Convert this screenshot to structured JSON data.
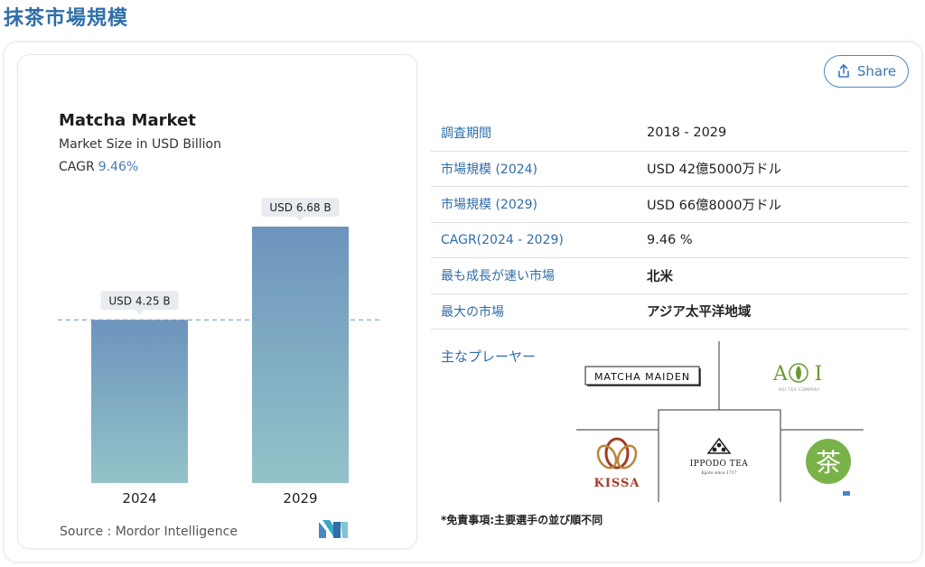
{
  "page_title": "抹茶市場規模",
  "share": {
    "label": "Share",
    "icon": "share-icon"
  },
  "chart": {
    "title": "Matcha Market",
    "subtitle": "Market Size in USD Billion",
    "cagr_label": "CAGR",
    "cagr_value": "9.46%",
    "source": "Source : Mordor Intelligence"
  },
  "chart_data": {
    "type": "bar",
    "categories": [
      "2024",
      "2029"
    ],
    "values": [
      4.25,
      6.68
    ],
    "data_labels": [
      "USD 4.25 B",
      "USD 6.68 B"
    ],
    "title": "Matcha Market",
    "subtitle": "Market Size in USD Billion",
    "ylim": [
      0,
      6.68
    ],
    "reference_line": 4.25,
    "grid": false,
    "colors": {
      "bar_top": "#6d94bd",
      "bar_bottom": "#93c3c9",
      "reference_line": "#7d9fc3",
      "label_bg": "#e8ebef"
    }
  },
  "table": {
    "rows": [
      {
        "label": "調査期間",
        "value": "2018 - 2029",
        "bold": false
      },
      {
        "label": "市場規模 (2024)",
        "value": "USD 42億5000万ドル",
        "bold": false
      },
      {
        "label": "市場規模 (2029)",
        "value": "USD 66億8000万ドル",
        "bold": false
      },
      {
        "label": "CAGR(2024 - 2029)",
        "value": "9.46 %",
        "bold": false
      },
      {
        "label": "最も成長が速い市場",
        "value": "北米",
        "bold": true
      },
      {
        "label": "最大の市場",
        "value": "アジア太平洋地域",
        "bold": true
      }
    ]
  },
  "players": {
    "label": "主なプレーヤー",
    "logos": {
      "matcha_maiden": "MATCHA MAIDEN",
      "aoi": "A",
      "aoi_letter2": "I",
      "aoi_tagline": "AOI TEA COMPANY",
      "kissa": "KISSA",
      "ippodo": "IPPODO TEA",
      "ippodo_tagline": "Kyoto since 1717",
      "cha": "茶"
    }
  },
  "disclaimer": "*免責事項:主要選手の並び順不同",
  "colors": {
    "accent": "#2f6ea8",
    "share_border": "#4a86c5",
    "aoi_green": "#6a9a2e",
    "kissa_red": "#a33b2a",
    "cha_green": "#7ab24a"
  }
}
